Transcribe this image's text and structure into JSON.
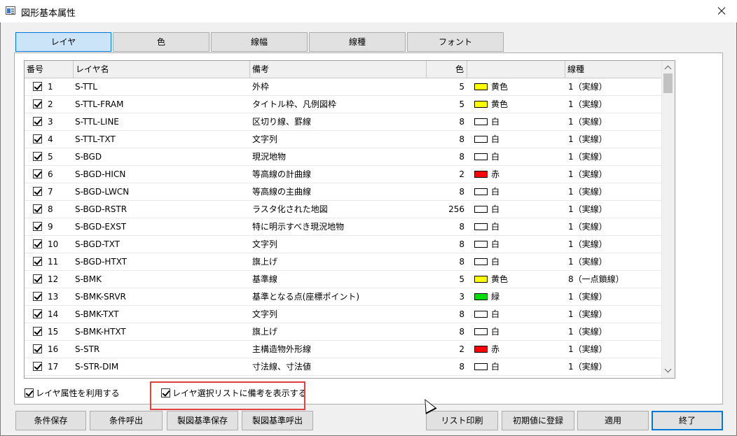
{
  "window": {
    "title": "図形基本属性"
  },
  "tabs": [
    {
      "label": "レイヤ",
      "active": true
    },
    {
      "label": "色",
      "active": false
    },
    {
      "label": "線幅",
      "active": false
    },
    {
      "label": "線種",
      "active": false
    },
    {
      "label": "フォント",
      "active": false
    }
  ],
  "table": {
    "headers": {
      "number": "番号",
      "layer_name": "レイヤ名",
      "note": "備考",
      "color": "色",
      "color_swatch": "",
      "linetype": "線種"
    },
    "rows": [
      {
        "checked": true,
        "number": "1",
        "name": "S-TTL",
        "note": "外枠",
        "color": "5",
        "color_name": "黄色",
        "color_hex": "#ffff00",
        "linetype": "1（実線）"
      },
      {
        "checked": true,
        "number": "2",
        "name": "S-TTL-FRAM",
        "note": "タイトル枠、凡例図枠",
        "color": "5",
        "color_name": "黄色",
        "color_hex": "#ffff00",
        "linetype": "1（実線）"
      },
      {
        "checked": true,
        "number": "3",
        "name": "S-TTL-LINE",
        "note": "区切り線、罫線",
        "color": "8",
        "color_name": "白",
        "color_hex": "#ffffff",
        "linetype": "1（実線）"
      },
      {
        "checked": true,
        "number": "4",
        "name": "S-TTL-TXT",
        "note": "文字列",
        "color": "8",
        "color_name": "白",
        "color_hex": "#ffffff",
        "linetype": "1（実線）"
      },
      {
        "checked": true,
        "number": "5",
        "name": "S-BGD",
        "note": "現況地物",
        "color": "8",
        "color_name": "白",
        "color_hex": "#ffffff",
        "linetype": "1（実線）"
      },
      {
        "checked": true,
        "number": "6",
        "name": "S-BGD-HICN",
        "note": "等高線の計曲線",
        "color": "2",
        "color_name": "赤",
        "color_hex": "#ff0000",
        "linetype": "1（実線）"
      },
      {
        "checked": true,
        "number": "7",
        "name": "S-BGD-LWCN",
        "note": "等高線の主曲線",
        "color": "8",
        "color_name": "白",
        "color_hex": "#ffffff",
        "linetype": "1（実線）"
      },
      {
        "checked": true,
        "number": "8",
        "name": "S-BGD-RSTR",
        "note": "ラスタ化された地図",
        "color": "256",
        "color_name": "白",
        "color_hex": "#ffffff",
        "linetype": "1（実線）"
      },
      {
        "checked": true,
        "number": "9",
        "name": "S-BGD-EXST",
        "note": "特に明示すべき現況地物",
        "color": "8",
        "color_name": "白",
        "color_hex": "#ffffff",
        "linetype": "1（実線）"
      },
      {
        "checked": true,
        "number": "10",
        "name": "S-BGD-TXT",
        "note": "文字列",
        "color": "8",
        "color_name": "白",
        "color_hex": "#ffffff",
        "linetype": "1（実線）"
      },
      {
        "checked": true,
        "number": "11",
        "name": "S-BGD-HTXT",
        "note": "旗上げ",
        "color": "8",
        "color_name": "白",
        "color_hex": "#ffffff",
        "linetype": "1（実線）"
      },
      {
        "checked": true,
        "number": "12",
        "name": "S-BMK",
        "note": "基準線",
        "color": "5",
        "color_name": "黄色",
        "color_hex": "#ffff00",
        "linetype": "8（一点鎖線）"
      },
      {
        "checked": true,
        "number": "13",
        "name": "S-BMK-SRVR",
        "note": "基準となる点(座標ポイント)",
        "color": "3",
        "color_name": "緑",
        "color_hex": "#00dd00",
        "linetype": "1（実線）"
      },
      {
        "checked": true,
        "number": "14",
        "name": "S-BMK-TXT",
        "note": "文字列",
        "color": "8",
        "color_name": "白",
        "color_hex": "#ffffff",
        "linetype": "1（実線）"
      },
      {
        "checked": true,
        "number": "15",
        "name": "S-BMK-HTXT",
        "note": "旗上げ",
        "color": "8",
        "color_name": "白",
        "color_hex": "#ffffff",
        "linetype": "1（実線）"
      },
      {
        "checked": true,
        "number": "16",
        "name": "S-STR",
        "note": "主構造物外形線",
        "color": "2",
        "color_name": "赤",
        "color_hex": "#ff0000",
        "linetype": "1（実線）"
      },
      {
        "checked": true,
        "number": "17",
        "name": "S-STR-DIM",
        "note": "寸法線、寸法値",
        "color": "8",
        "color_name": "白",
        "color_hex": "#ffffff",
        "linetype": "1（実線）"
      }
    ]
  },
  "options": {
    "use_layer_attr": "レイヤ属性を利用する",
    "show_notes": "レイヤ選択リストに備考を表示する"
  },
  "buttons": {
    "save_conditions": "条件保存",
    "load_conditions": "条件呼出",
    "save_standard": "製図基準保存",
    "load_standard": "製図基準呼出",
    "print_list": "リスト印刷",
    "register_default": "初期値に登録",
    "apply": "適用",
    "close": "終了"
  }
}
